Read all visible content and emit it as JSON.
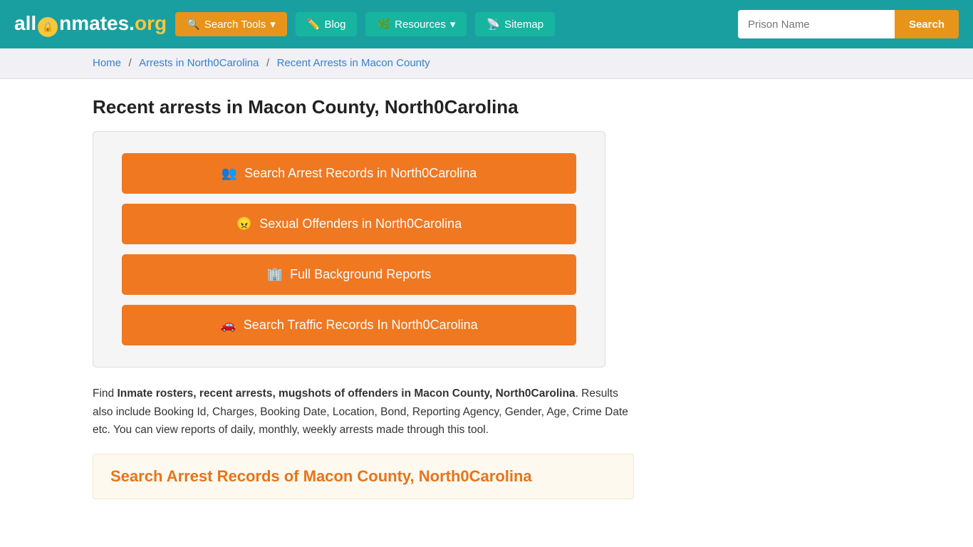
{
  "header": {
    "logo": {
      "part1": "all",
      "part2": "Inmates",
      "part3": ".org"
    },
    "nav": [
      {
        "id": "search-tools",
        "label": "Search Tools",
        "icon": "🔍",
        "hasDropdown": true
      },
      {
        "id": "blog",
        "label": "Blog",
        "icon": "✏️",
        "hasDropdown": false
      },
      {
        "id": "resources",
        "label": "Resources",
        "icon": "🌿",
        "hasDropdown": true
      },
      {
        "id": "sitemap",
        "label": "Sitemap",
        "icon": "📡",
        "hasDropdown": false
      }
    ],
    "search_placeholder": "Prison Name",
    "search_button": "Search"
  },
  "breadcrumb": {
    "items": [
      {
        "label": "Home",
        "href": "#"
      },
      {
        "label": "Arrests in North0Carolina",
        "href": "#"
      },
      {
        "label": "Recent Arrests in Macon County",
        "href": "#"
      }
    ]
  },
  "page": {
    "title": "Recent arrests in Macon County, North0Carolina",
    "buttons": [
      {
        "id": "arrest-records",
        "icon": "👥",
        "label": "Search Arrest Records in North0Carolina"
      },
      {
        "id": "sex-offenders",
        "icon": "😠",
        "label": "Sexual Offenders in North0Carolina"
      },
      {
        "id": "background-reports",
        "icon": "🏢",
        "label": "Full Background Reports"
      },
      {
        "id": "traffic-records",
        "icon": "🚗",
        "label": "Search Traffic Records In North0Carolina"
      }
    ],
    "description_plain": ". Results also include Booking Id, Charges, Booking Date, Location, Bond, Reporting Agency, Gender, Age, Crime Date etc. You can view reports of daily, monthly, weekly arrests made through this tool.",
    "description_bold": "Inmate rosters, recent arrests, mugshots of offenders in Macon County, North0Carolina",
    "description_prefix": "Find ",
    "section_heading": "Search Arrest Records of Macon County, North0Carolina"
  }
}
